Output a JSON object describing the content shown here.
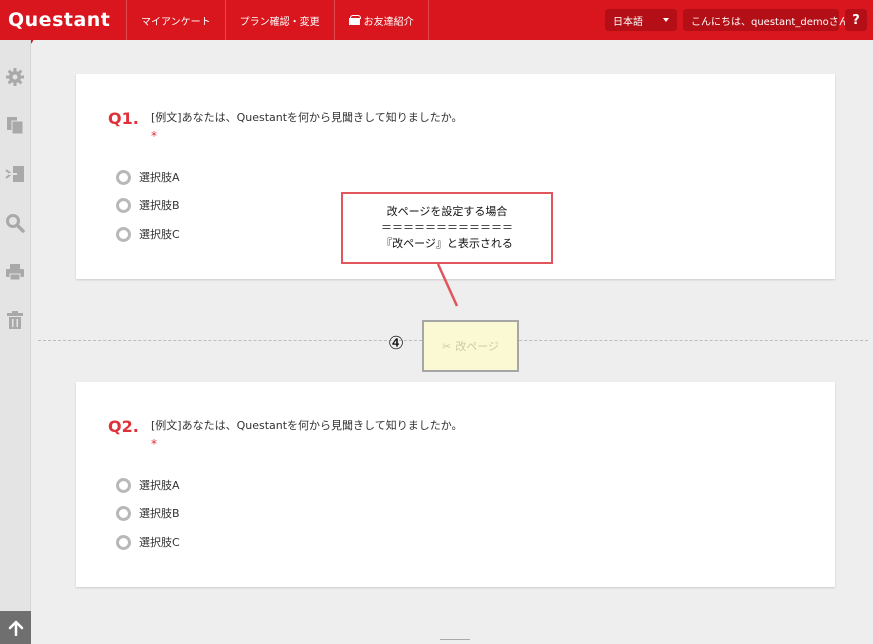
{
  "app": {
    "logo": "Questant",
    "nav": [
      {
        "label": "マイアンケート"
      },
      {
        "label": "プラン確認・変更"
      },
      {
        "label": "お友達紹介"
      }
    ],
    "language": "日本語",
    "greeting": "こんにちは、questant_demoさん",
    "help": "?"
  },
  "sidebar": {
    "icons": [
      "gear-icon",
      "copy-icon",
      "branch-icon",
      "search-icon",
      "print-icon",
      "trash-icon"
    ],
    "scroll_top": "arrow-up-icon"
  },
  "questions": [
    {
      "number": "Q1.",
      "text": "[例文]あなたは、Questantを何から見聞きして知りましたか。",
      "required": "*",
      "options": [
        "選択肢A",
        "選択肢B",
        "選択肢C"
      ]
    },
    {
      "number": "Q2.",
      "text": "[例文]あなたは、Questantを何から見聞きして知りましたか。",
      "required": "*",
      "options": [
        "選択肢A",
        "選択肢B",
        "選択肢C"
      ]
    }
  ],
  "page_break": {
    "label": "改ページ",
    "marker": "④"
  },
  "callout": {
    "line1": "改ページを設定する場合",
    "line2": "＝＝＝＝＝＝＝＝＝＝＝＝",
    "line3": "『改ページ』と表示される"
  },
  "colors": {
    "brand": "#d9161e",
    "accent": "#e0303a",
    "callout_border": "#e0565c"
  }
}
